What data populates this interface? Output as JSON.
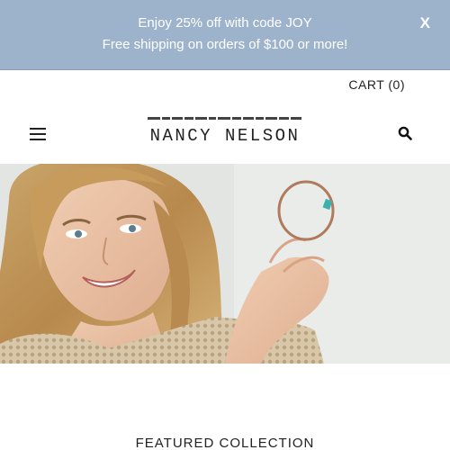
{
  "announcement": {
    "line1": "Enjoy 25% off with code JOY",
    "line2": "Free shipping on orders of $100 or more!",
    "close_label": "X"
  },
  "header": {
    "cart_label": "CART (0)",
    "logo_text": "NANCY NELSON",
    "menu_icon": "hamburger-icon",
    "search_icon": "search-icon"
  },
  "hero": {
    "image": "woman-holding-bracelet"
  },
  "featured": {
    "title": "FEATURED COLLECTION"
  },
  "colors": {
    "announcement_bg": "#9db3cc",
    "text": "#222222"
  }
}
